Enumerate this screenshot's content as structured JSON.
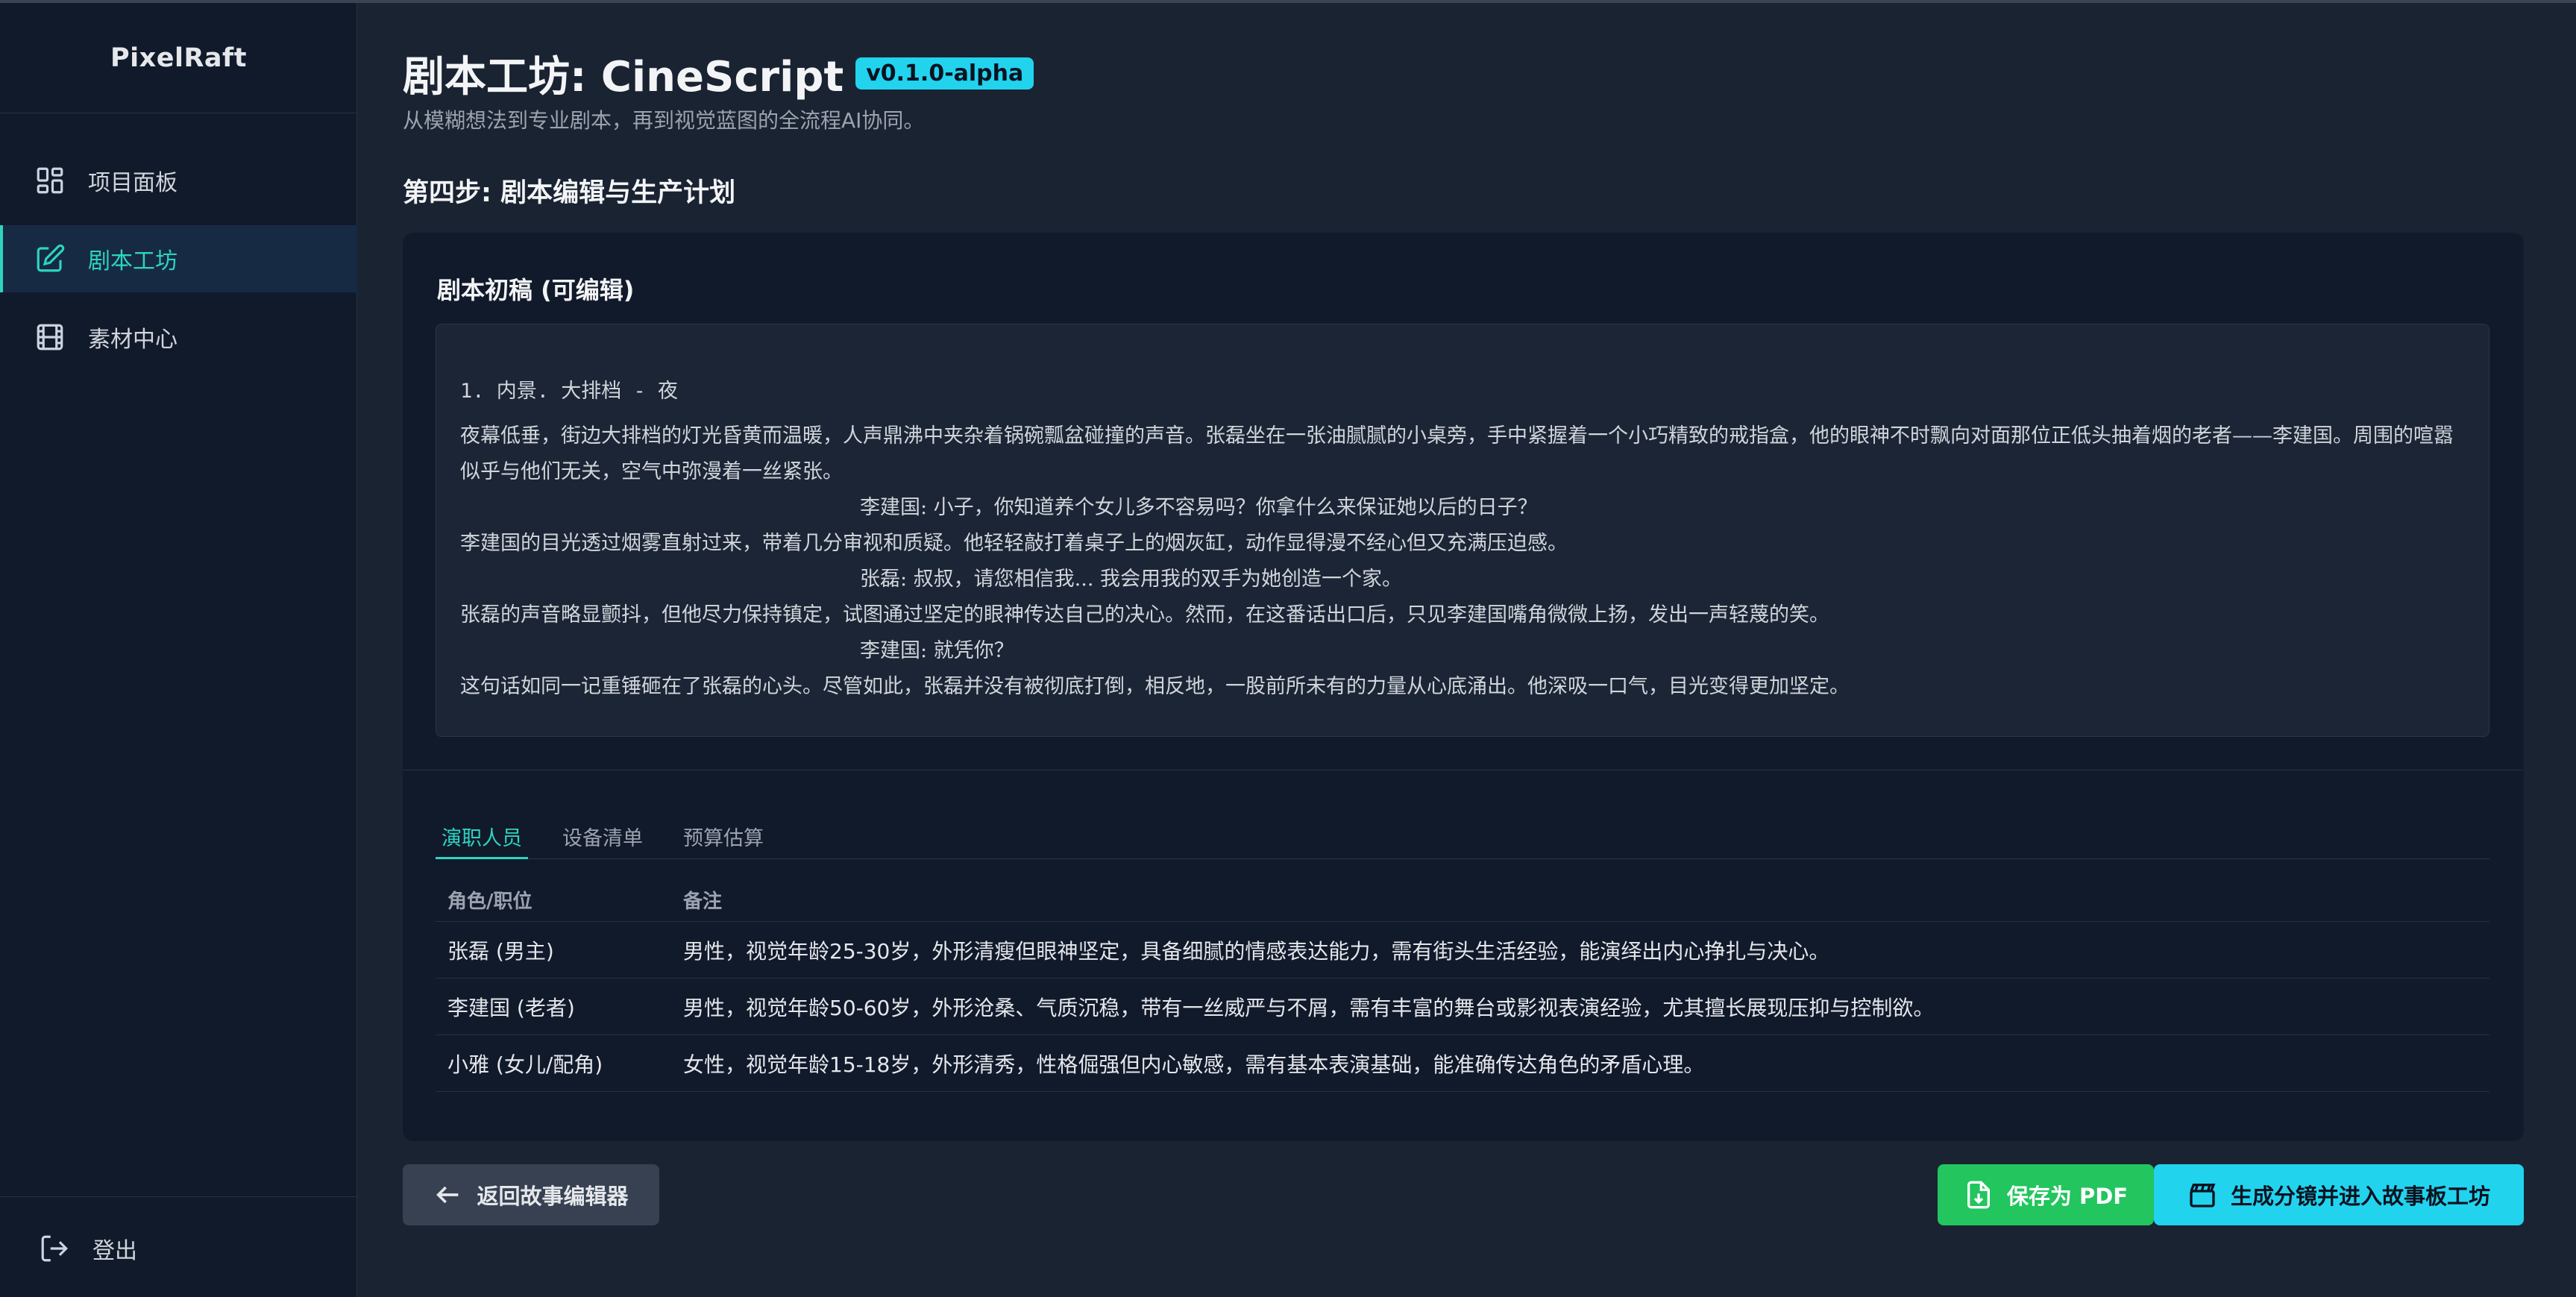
{
  "sidebar": {
    "brand": "PixelRaft",
    "items": [
      {
        "label": "项目面板",
        "icon": "dashboard-icon"
      },
      {
        "label": "剧本工坊",
        "icon": "edit-icon",
        "active": true
      },
      {
        "label": "素材中心",
        "icon": "film-icon"
      }
    ],
    "logout_label": "登出"
  },
  "header": {
    "title": "剧本工坊: CineScript",
    "version": "v0.1.0-alpha",
    "subtitle": "从模糊想法到专业剧本，再到视觉蓝图的全流程AI协同。"
  },
  "step_title": "第四步: 剧本编辑与生产计划",
  "script": {
    "card_title": "剧本初稿 (可编辑)",
    "scene_heading": "1. 内景. 大排档 - 夜",
    "lines": [
      {
        "type": "action",
        "text": "夜幕低垂，街边大排档的灯光昏黄而温暖，人声鼎沸中夹杂着锅碗瓢盆碰撞的声音。张磊坐在一张油腻腻的小桌旁，手中紧握着一个小巧精致的戒指盒，他的眼神不时飘向对面那位正低头抽着烟的老者——李建国。周围的喧嚣似乎与他们无关，空气中弥漫着一丝紧张。"
      },
      {
        "type": "dialog",
        "text": "李建国:  小子，你知道养个女儿多不容易吗？你拿什么来保证她以后的日子？"
      },
      {
        "type": "action",
        "text": "李建国的目光透过烟雾直射过来，带着几分审视和质疑。他轻轻敲打着桌子上的烟灰缸，动作显得漫不经心但又充满压迫感。"
      },
      {
        "type": "dialog",
        "text": "张磊:  叔叔，请您相信我... 我会用我的双手为她创造一个家。"
      },
      {
        "type": "action",
        "text": "张磊的声音略显颤抖，但他尽力保持镇定，试图通过坚定的眼神传达自己的决心。然而，在这番话出口后，只见李建国嘴角微微上扬，发出一声轻蔑的笑。"
      },
      {
        "type": "dialog",
        "text": "李建国:  就凭你？"
      },
      {
        "type": "action",
        "text": "这句话如同一记重锤砸在了张磊的心头。尽管如此，张磊并没有被彻底打倒，相反地，一股前所未有的力量从心底涌出。他深吸一口气，目光变得更加坚定。"
      }
    ]
  },
  "tabs": [
    {
      "label": "演职人员",
      "active": true
    },
    {
      "label": "设备清单"
    },
    {
      "label": "预算估算"
    }
  ],
  "cast_table": {
    "headers": [
      "角色/职位",
      "备注"
    ],
    "rows": [
      [
        "张磊 (男主)",
        "男性，视觉年龄25-30岁，外形清瘦但眼神坚定，具备细腻的情感表达能力，需有街头生活经验，能演绎出内心挣扎与决心。"
      ],
      [
        "李建国 (老者)",
        "男性，视觉年龄50-60岁，外形沧桑、气质沉稳，带有一丝威严与不屑，需有丰富的舞台或影视表演经验，尤其擅长展现压抑与控制欲。"
      ],
      [
        "小雅 (女儿/配角)",
        "女性，视觉年龄15-18岁，外形清秀，性格倔强但内心敏感，需有基本表演基础，能准确传达角色的矛盾心理。"
      ]
    ]
  },
  "actions": {
    "back_label": "返回故事编辑器",
    "pdf_label": "保存为 PDF",
    "generate_label": "生成分镜并进入故事板工坊"
  },
  "colors": {
    "accent": "#2dd4bf",
    "version_badge": "#22d3ee",
    "pdf_button": "#22c55e",
    "generate_button": "#22d3ee",
    "background": "#1a2332",
    "sidebar": "#111a2b"
  }
}
